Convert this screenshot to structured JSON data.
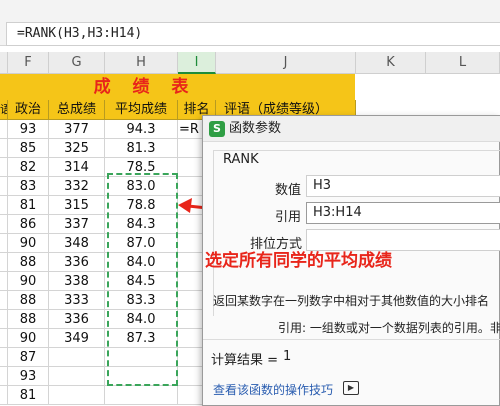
{
  "formula_bar": {
    "formula": "=RANK(H3,H3:H14)"
  },
  "columns": [
    "F",
    "G",
    "H",
    "I",
    "J",
    "K",
    "L"
  ],
  "selected_column": "I",
  "sheet_title": "成 绩 表",
  "table_headers": [
    "政治",
    "总成绩",
    "平均成绩",
    "排名",
    "评语（成绩等级）"
  ],
  "first_header_fragment": "语",
  "rows": [
    {
      "zhengzhi": "93",
      "zongchengji": "377",
      "pingjun": "94.3",
      "paiming": "=R"
    },
    {
      "zhengzhi": "85",
      "zongchengji": "325",
      "pingjun": "81.3",
      "paiming": ""
    },
    {
      "zhengzhi": "82",
      "zongchengji": "314",
      "pingjun": "78.5",
      "paiming": ""
    },
    {
      "zhengzhi": "83",
      "zongchengji": "332",
      "pingjun": "83.0",
      "paiming": ""
    },
    {
      "zhengzhi": "81",
      "zongchengji": "315",
      "pingjun": "78.8",
      "paiming": ""
    },
    {
      "zhengzhi": "86",
      "zongchengji": "337",
      "pingjun": "84.3",
      "paiming": ""
    },
    {
      "zhengzhi": "90",
      "zongchengji": "348",
      "pingjun": "87.0",
      "paiming": ""
    },
    {
      "zhengzhi": "88",
      "zongchengji": "336",
      "pingjun": "84.0",
      "paiming": ""
    },
    {
      "zhengzhi": "90",
      "zongchengji": "338",
      "pingjun": "84.5",
      "paiming": ""
    },
    {
      "zhengzhi": "88",
      "zongchengji": "333",
      "pingjun": "83.3",
      "paiming": ""
    },
    {
      "zhengzhi": "88",
      "zongchengji": "336",
      "pingjun": "84.0",
      "paiming": ""
    },
    {
      "zhengzhi": "90",
      "zongchengji": "349",
      "pingjun": "87.3",
      "paiming": ""
    },
    {
      "zhengzhi": "87",
      "zongchengji": "",
      "pingjun": "",
      "paiming": ""
    },
    {
      "zhengzhi": "93",
      "zongchengji": "",
      "pingjun": "",
      "paiming": ""
    },
    {
      "zhengzhi": "81",
      "zongchengji": "",
      "pingjun": "",
      "paiming": ""
    }
  ],
  "dialog": {
    "title": "函数参数",
    "logo": "S",
    "function_name": "RANK",
    "fields": [
      {
        "label": "数值",
        "value": "H3"
      },
      {
        "label": "引用",
        "value": "H3:H14"
      },
      {
        "label": "排位方式",
        "value": ""
      }
    ],
    "description": "返回某数字在一列数字中相对于其他数值的大小排名",
    "param_help": "引用:  一组数或对一个数据列表的引用。非",
    "result_label": "计算结果 =",
    "result_value": "1",
    "help_link": "查看该函数的操作技巧"
  },
  "annotation": "选定所有同学的平均成绩",
  "colors": {
    "banner": "#f5c518",
    "title_red": "#e8251a",
    "selection_green": "#3aa55a",
    "arrow_red": "#e8251a"
  }
}
